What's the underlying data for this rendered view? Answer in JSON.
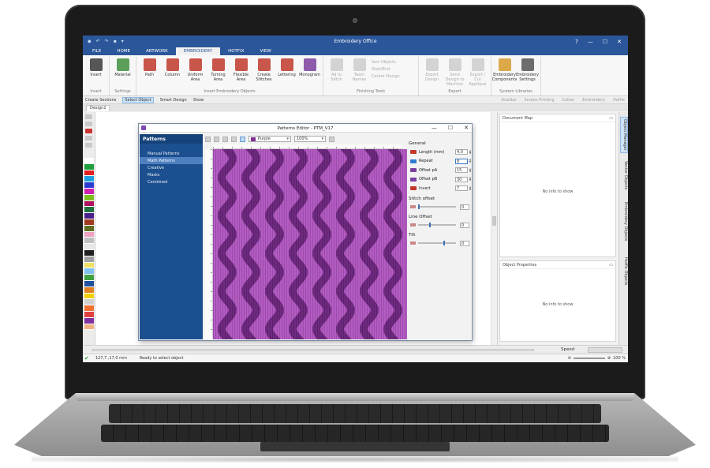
{
  "window": {
    "app_title": "Embroidery Office",
    "controls": [
      "?",
      "—",
      "☐",
      "✕"
    ]
  },
  "menu": {
    "tabs": [
      "FILE",
      "HOME",
      "ARTWORK",
      "EMBROIDERY",
      "HOTFIX",
      "VIEW"
    ],
    "active": "EMBROIDERY"
  },
  "ribbon": {
    "groups": [
      {
        "label": "Insert",
        "buttons": [
          {
            "label": "Insert",
            "icon": "insert-icon",
            "color": "#3a3a3a"
          }
        ]
      },
      {
        "label": "Settings",
        "buttons": [
          {
            "label": "Material",
            "icon": "material-icon",
            "color": "#3f8f3f"
          }
        ]
      },
      {
        "label": "Insert Embroidery Objects",
        "buttons": [
          {
            "label": "Path",
            "icon": "path-icon",
            "color": "#c0392b"
          },
          {
            "label": "Column",
            "icon": "column-icon",
            "color": "#c0392b"
          },
          {
            "label": "Uniform Area",
            "icon": "uniform-area-icon",
            "color": "#c0392b"
          },
          {
            "label": "Turning Area",
            "icon": "turning-area-icon",
            "color": "#c0392b"
          },
          {
            "label": "Flexible Area",
            "icon": "flexible-area-icon",
            "color": "#c0392b"
          },
          {
            "label": "Create Stitches",
            "icon": "create-stitches-icon",
            "color": "#c0392b"
          },
          {
            "label": "Lettering",
            "icon": "lettering-icon",
            "color": "#c0392b"
          },
          {
            "label": "Monogram",
            "icon": "monogram-icon",
            "color": "#7b3fa0"
          }
        ]
      },
      {
        "label": "Finishing Tools",
        "buttons": [
          {
            "label": "Ad to Stitch",
            "icon": "add-to-stitch-icon",
            "color": "#bbbbbb"
          },
          {
            "label": "Team Names",
            "icon": "team-names-icon",
            "color": "#bbbbbb"
          }
        ],
        "small": [
          "Sort Objects",
          "Start/End",
          "Center Design"
        ]
      },
      {
        "label": "Export",
        "buttons": [
          {
            "label": "Export Design",
            "icon": "export-design-icon",
            "color": "#bbbbbb"
          },
          {
            "label": "Send Design to Machine",
            "icon": "send-design-icon",
            "color": "#bbbbbb"
          },
          {
            "label": "Export / Cut Appliqué",
            "icon": "export-cut-icon",
            "color": "#bbbbbb"
          }
        ]
      },
      {
        "label": "System Libraries",
        "buttons": [
          {
            "label": "Embroidery Components",
            "icon": "components-icon",
            "color": "#d89a2b"
          },
          {
            "label": "Embroidery Settings",
            "icon": "settings-gear-icon",
            "color": "#555555"
          }
        ]
      }
    ]
  },
  "toolbar2": {
    "create_sections": "Create Sections",
    "select_object": "Select Object",
    "smart_design": "Smart Design",
    "show": "Show",
    "right_items": [
      "Auxiliar",
      "Screen Printing",
      "Cutter",
      "Embroidery",
      "Hotfix"
    ]
  },
  "doc_tab": "Design2",
  "palette_colors": [
    "#ffffff",
    "#1f9e3c",
    "#e02020",
    "#1ea0e0",
    "#2b3bd0",
    "#d020b0",
    "#7cc020",
    "#b01060",
    "#207040",
    "#4a1f8a",
    "#a03a20",
    "#607020",
    "#f0a0c0",
    "#c0c0c0",
    "#e8e8e8",
    "#202020",
    "#a0a0a0",
    "#f0e060",
    "#80c0f0",
    "#40a040",
    "#2050a0",
    "#e08020",
    "#f0d000",
    "#d0d0d0",
    "#f07030",
    "#e04040",
    "#8030a0",
    "#f0b080"
  ],
  "dialog": {
    "title": "Patterns Editor - PTM_V17",
    "sidebar_header": "Patterns",
    "nav": [
      "Manual Patterns",
      "Math Patterns",
      "Creative",
      "Masks",
      "Combined"
    ],
    "nav_active": 1,
    "color_combo": "Purple",
    "zoom_combo": "100%",
    "general_header": "General",
    "params": [
      {
        "label": "Length (mm)",
        "value": "4,0",
        "icon": "length-icon"
      },
      {
        "label": "Repeat",
        "value": "8",
        "icon": "repeat-icon"
      },
      {
        "label": "Offset pA",
        "value": "15",
        "icon": "offset-pa-icon"
      },
      {
        "label": "Offset pB",
        "value": "30",
        "icon": "offset-pb-icon"
      },
      {
        "label": "Invert",
        "value": "7",
        "icon": "invert-icon"
      }
    ],
    "sliders": [
      {
        "header": "Stitch offset",
        "value": "0",
        "level": 0.0
      },
      {
        "header": "Line Offset",
        "value": "0",
        "level": 0.3
      },
      {
        "header": "Tilt",
        "value": "0",
        "level": 0.7
      }
    ],
    "pattern_color_light": "#b35cc2",
    "pattern_color_dark": "#6f2a80"
  },
  "panels": {
    "document_map": {
      "title": "Document Map",
      "empty": "No info to show"
    },
    "object_properties": {
      "title": "Object Properties",
      "empty": "No info to show"
    }
  },
  "side_tabs": [
    "Object Manager",
    "Vector Objects",
    "Embroidery Objects",
    "Hotfix Objects"
  ],
  "bottom": {
    "speed_label": "Speed"
  },
  "status": {
    "coords": "127,7 ,17,0 mm",
    "message": "Ready to select object",
    "zoom": "100 %"
  }
}
